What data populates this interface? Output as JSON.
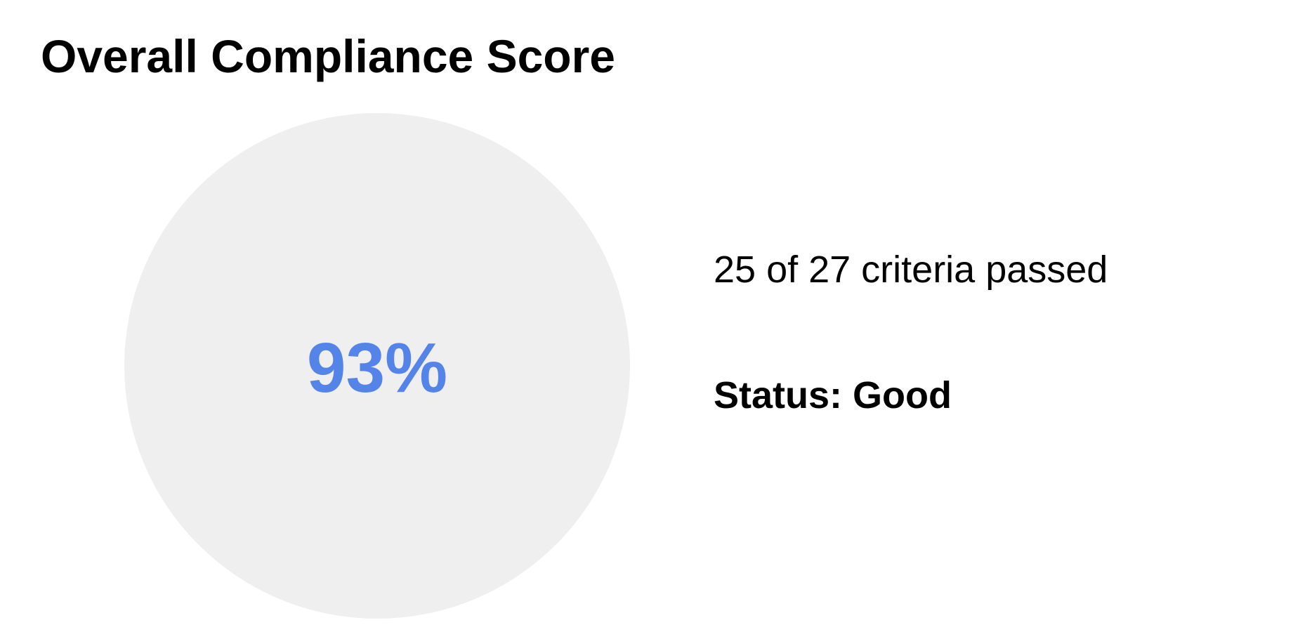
{
  "title": "Overall Compliance Score",
  "score": {
    "value": "93%",
    "color": "#5584e9",
    "circle_color": "#efefef"
  },
  "criteria": {
    "text": "25 of 27 criteria passed"
  },
  "status": {
    "text": "Status: Good"
  }
}
